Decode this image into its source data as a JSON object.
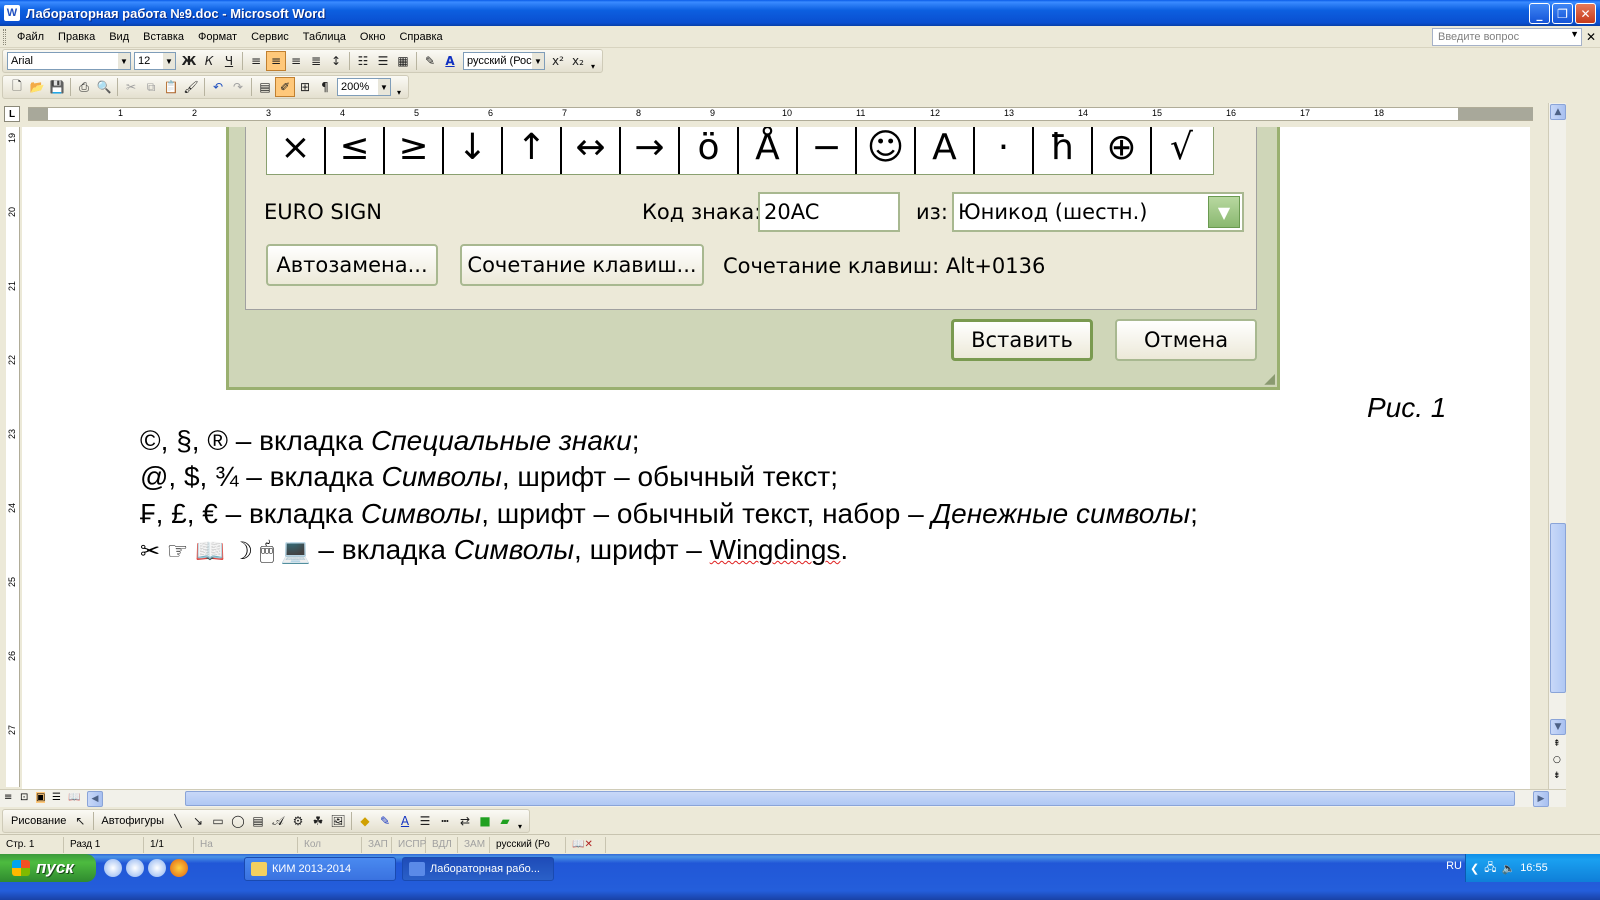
{
  "window": {
    "title": "Лабораторная работа №9.doc - Microsoft Word",
    "app_icon": "W",
    "buttons": {
      "minimize": "_",
      "maximize": "❐",
      "close": "✕"
    }
  },
  "menu": {
    "items": [
      "Файл",
      "Правка",
      "Вид",
      "Вставка",
      "Формат",
      "Сервис",
      "Таблица",
      "Окно",
      "Справка"
    ],
    "help_placeholder": "Введите вопрос"
  },
  "format_toolbar": {
    "font": "Arial",
    "size": "12",
    "bold": "Ж",
    "italic": "К",
    "underline": "Ч",
    "language": "русский (Росс"
  },
  "standard_toolbar": {
    "zoom": "200%"
  },
  "ruler": {
    "numbers": [
      "1",
      "2",
      "3",
      "4",
      "5",
      "6",
      "7",
      "8",
      "9",
      "10",
      "11",
      "12",
      "13",
      "14",
      "15",
      "16",
      "17",
      "18"
    ],
    "vertical_numbers": [
      "19",
      "20",
      "21",
      "22",
      "23",
      "24",
      "25",
      "26",
      "27"
    ]
  },
  "dialog": {
    "symbols": [
      "×",
      "≤",
      "≥",
      "↓",
      "↑",
      "↔",
      "→",
      "ö",
      "Å",
      "−",
      "☺",
      "A",
      "·",
      "ħ",
      "⊕",
      "√"
    ],
    "char_name": "EURO SIGN",
    "code_label": "Код знака:",
    "code_value": "20AC",
    "from_label": "из:",
    "from_value": "Юникод (шестн.)",
    "autocorrect_button": "Автозамена...",
    "shortcut_button": "Сочетание клавиш...",
    "shortcut_text": "Сочетание клавиш: Alt+0136",
    "insert_button": "Вставить",
    "cancel_button": "Отмена"
  },
  "document": {
    "caption": "Рис. 1",
    "line1": {
      "prefix": "©, §, ® – вкладка ",
      "italic": "Специальные знаки",
      "suffix": ";"
    },
    "line2": {
      "prefix": "@, $, ¾ – вкладка ",
      "italic": "Символы",
      "suffix": ", шрифт – обычный текст;"
    },
    "line3": {
      "prefix": "₣, £, € – вкладка ",
      "italic": "Символы",
      "middle": ", шрифт – обычный текст, набор – ",
      "italic2": "Денежные символы",
      "suffix": ";"
    },
    "line4": {
      "glyphs": "✂  ☞  📖  ☽  🖱  💻",
      "prefix": " – вкладка ",
      "italic": "Символы",
      "middle": ", шрифт – ",
      "word": "Wingdings",
      "suffix": "."
    }
  },
  "drawing_toolbar": {
    "drawing": "Рисование",
    "autoshapes": "Автофигуры"
  },
  "statusbar": {
    "page": "Стр. 1",
    "section": "Разд 1",
    "pages": "1/1",
    "at": "На",
    "col": "Кол",
    "rec": "ЗАП",
    "trk": "ИСПР",
    "ext": "ВДЛ",
    "ovr": "ЗАМ",
    "language": "русский (Ро"
  },
  "taskbar": {
    "start": "пуск",
    "tasks": [
      "КИМ 2013-2014",
      "Лабораторная рабо..."
    ],
    "lang": "RU",
    "clock": "16:55"
  }
}
